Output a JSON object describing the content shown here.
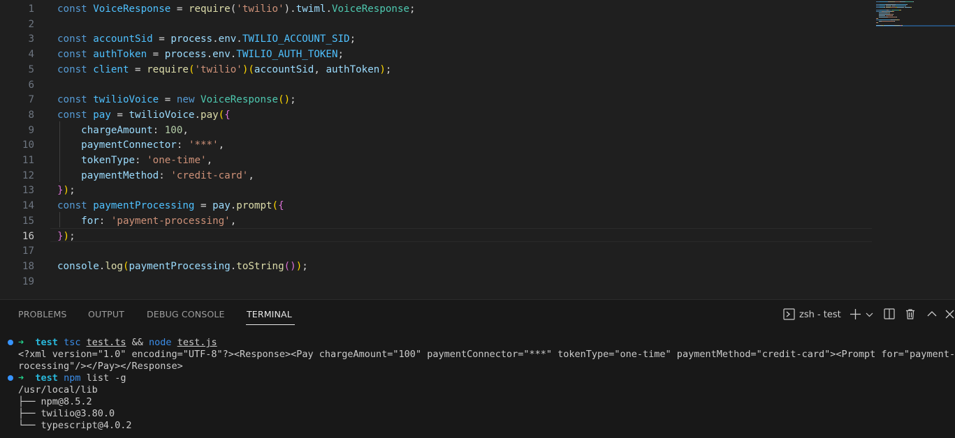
{
  "editor": {
    "active_line": "16",
    "lines": [
      {
        "n": "1",
        "segs": [
          [
            "kw",
            "const"
          ],
          [
            "p",
            " "
          ],
          [
            "v",
            "VoiceResponse"
          ],
          [
            "p",
            " = "
          ],
          [
            "fn",
            "require"
          ],
          [
            "p",
            "("
          ],
          [
            "s",
            "'twilio'"
          ],
          [
            "p",
            ")."
          ],
          [
            "prop",
            "twiml"
          ],
          [
            "p",
            "."
          ],
          [
            "cls",
            "VoiceResponse"
          ],
          [
            "p",
            ";"
          ]
        ]
      },
      {
        "n": "2",
        "segs": []
      },
      {
        "n": "3",
        "segs": [
          [
            "kw",
            "const"
          ],
          [
            "p",
            " "
          ],
          [
            "v",
            "accountSid"
          ],
          [
            "p",
            " = "
          ],
          [
            "prop",
            "process"
          ],
          [
            "p",
            "."
          ],
          [
            "prop",
            "env"
          ],
          [
            "p",
            "."
          ],
          [
            "const",
            "TWILIO_ACCOUNT_SID"
          ],
          [
            "p",
            ";"
          ]
        ]
      },
      {
        "n": "4",
        "segs": [
          [
            "kw",
            "const"
          ],
          [
            "p",
            " "
          ],
          [
            "v",
            "authToken"
          ],
          [
            "p",
            " = "
          ],
          [
            "prop",
            "process"
          ],
          [
            "p",
            "."
          ],
          [
            "prop",
            "env"
          ],
          [
            "p",
            "."
          ],
          [
            "const",
            "TWILIO_AUTH_TOKEN"
          ],
          [
            "p",
            ";"
          ]
        ]
      },
      {
        "n": "5",
        "segs": [
          [
            "kw",
            "const"
          ],
          [
            "p",
            " "
          ],
          [
            "v",
            "client"
          ],
          [
            "p",
            " = "
          ],
          [
            "fn",
            "require"
          ],
          [
            "b1",
            "("
          ],
          [
            "s",
            "'twilio'"
          ],
          [
            "b1",
            ")"
          ],
          [
            "b1",
            "("
          ],
          [
            "prop",
            "accountSid"
          ],
          [
            "p",
            ", "
          ],
          [
            "prop",
            "authToken"
          ],
          [
            "b1",
            ")"
          ],
          [
            "p",
            ";"
          ]
        ]
      },
      {
        "n": "6",
        "segs": []
      },
      {
        "n": "7",
        "segs": [
          [
            "kw",
            "const"
          ],
          [
            "p",
            " "
          ],
          [
            "v",
            "twilioVoice"
          ],
          [
            "p",
            " = "
          ],
          [
            "kw",
            "new"
          ],
          [
            "p",
            " "
          ],
          [
            "cls",
            "VoiceResponse"
          ],
          [
            "b1",
            "()"
          ],
          [
            "p",
            ";"
          ]
        ]
      },
      {
        "n": "8",
        "segs": [
          [
            "kw",
            "const"
          ],
          [
            "p",
            " "
          ],
          [
            "v",
            "pay"
          ],
          [
            "p",
            " = "
          ],
          [
            "prop",
            "twilioVoice"
          ],
          [
            "p",
            "."
          ],
          [
            "fn",
            "pay"
          ],
          [
            "b1",
            "("
          ],
          [
            "b2",
            "{"
          ]
        ]
      },
      {
        "n": "9",
        "segs": [
          [
            "p",
            "    "
          ],
          [
            "prop",
            "chargeAmount"
          ],
          [
            "p",
            ": "
          ],
          [
            "num",
            "100"
          ],
          [
            "p",
            ","
          ]
        ]
      },
      {
        "n": "10",
        "segs": [
          [
            "p",
            "    "
          ],
          [
            "prop",
            "paymentConnector"
          ],
          [
            "p",
            ": "
          ],
          [
            "s",
            "'***'"
          ],
          [
            "p",
            ","
          ]
        ]
      },
      {
        "n": "11",
        "segs": [
          [
            "p",
            "    "
          ],
          [
            "prop",
            "tokenType"
          ],
          [
            "p",
            ": "
          ],
          [
            "s",
            "'one-time'"
          ],
          [
            "p",
            ","
          ]
        ]
      },
      {
        "n": "12",
        "segs": [
          [
            "p",
            "    "
          ],
          [
            "prop",
            "paymentMethod"
          ],
          [
            "p",
            ": "
          ],
          [
            "s",
            "'credit-card'"
          ],
          [
            "p",
            ","
          ]
        ]
      },
      {
        "n": "13",
        "segs": [
          [
            "b2",
            "}"
          ],
          [
            "b1",
            ")"
          ],
          [
            "p",
            ";"
          ]
        ]
      },
      {
        "n": "14",
        "segs": [
          [
            "kw",
            "const"
          ],
          [
            "p",
            " "
          ],
          [
            "v",
            "paymentProcessing"
          ],
          [
            "p",
            " = "
          ],
          [
            "prop",
            "pay"
          ],
          [
            "p",
            "."
          ],
          [
            "fn",
            "prompt"
          ],
          [
            "b1",
            "("
          ],
          [
            "b2",
            "{"
          ]
        ]
      },
      {
        "n": "15",
        "segs": [
          [
            "p",
            "    "
          ],
          [
            "prop",
            "for"
          ],
          [
            "p",
            ": "
          ],
          [
            "s",
            "'payment-processing'"
          ],
          [
            "p",
            ","
          ]
        ]
      },
      {
        "n": "16",
        "segs": [
          [
            "b2",
            "}"
          ],
          [
            "b1",
            ")"
          ],
          [
            "p",
            ";"
          ]
        ]
      },
      {
        "n": "17",
        "segs": []
      },
      {
        "n": "18",
        "segs": [
          [
            "prop",
            "console"
          ],
          [
            "p",
            "."
          ],
          [
            "fn",
            "log"
          ],
          [
            "b1",
            "("
          ],
          [
            "prop",
            "paymentProcessing"
          ],
          [
            "p",
            "."
          ],
          [
            "fn",
            "toString"
          ],
          [
            "b2",
            "()"
          ],
          [
            "b1",
            ")"
          ],
          [
            "p",
            ";"
          ]
        ]
      },
      {
        "n": "19",
        "segs": []
      }
    ]
  },
  "colors": {
    "kw": "#569cd6",
    "v": "#4fc1ff",
    "fn": "#dcdcaa",
    "s": "#ce9178",
    "prop": "#9cdcfe",
    "cls": "#4ec9b0",
    "const": "#4fc1ff",
    "num": "#b5cea8",
    "p": "#d4d4d4",
    "b1": "#ffd700",
    "b2": "#da70d6",
    "prompt_arrow": "#23d18b",
    "prompt_dir": "#29b8db",
    "prompt_cmd": "#3b8eea",
    "term_text": "#cccccc",
    "dot": "#3794ff"
  },
  "panel": {
    "tabs": [
      "PROBLEMS",
      "OUTPUT",
      "DEBUG CONSOLE",
      "TERMINAL"
    ],
    "active_tab": "TERMINAL",
    "terminal_label": "zsh - test",
    "icons": [
      "terminal-icon",
      "plus-icon",
      "chevron-down-icon",
      "split-icon",
      "trash-icon",
      "chevron-up-icon",
      "close-icon"
    ]
  },
  "terminal": {
    "prompt_arrow": "➜",
    "prompt_dir": "test",
    "cmd1": {
      "a": "tsc",
      "b": "test.ts",
      "c": "&&",
      "d": "node",
      "e": "test.js"
    },
    "output1_line1": "<?xml version=\"1.0\" encoding=\"UTF-8\"?><Response><Pay chargeAmount=\"100\" paymentConnector=\"***\" tokenType=\"one-time\" paymentMethod=\"credit-card\"><Prompt for=\"payment-p",
    "output1_line2": "rocessing\"/></Pay></Response>",
    "cmd2": {
      "a": "npm",
      "b": "list -g"
    },
    "tree": [
      "/usr/local/lib",
      "├── npm@8.5.2",
      "├── twilio@3.80.0",
      "└── typescript@4.0.2"
    ]
  }
}
